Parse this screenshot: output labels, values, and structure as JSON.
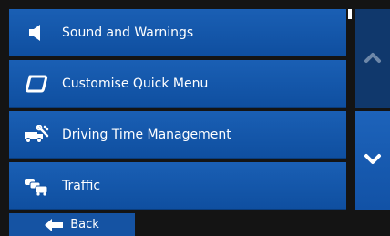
{
  "menu": {
    "items": [
      {
        "label": "Sound and Warnings",
        "icon": "speaker-icon"
      },
      {
        "label": "Customise Quick Menu",
        "icon": "quick-menu-icon"
      },
      {
        "label": "Driving Time Management",
        "icon": "truck-tool-icon"
      },
      {
        "label": "Traffic",
        "icon": "traffic-cars-icon"
      }
    ]
  },
  "scroll": {
    "up_icon": "chevron-up-icon",
    "down_icon": "chevron-down-icon"
  },
  "footer": {
    "back_label": "Back",
    "back_icon": "arrow-left-icon"
  },
  "colors": {
    "item_blue": "#1a5fb4",
    "scroll_up_dark": "#10386c",
    "background": "#141414"
  }
}
